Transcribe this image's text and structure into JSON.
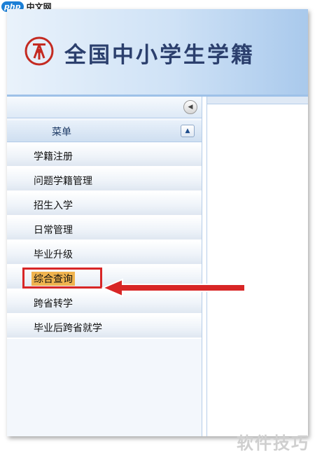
{
  "watermark": {
    "site_badge": "php",
    "site_name": "中文网",
    "corner_text": "软件技巧"
  },
  "header": {
    "title": "全国中小学生学籍",
    "logo_icon": "national-student-emblem-icon"
  },
  "panel": {
    "menu_title": "菜单",
    "collapse_icon": "left-arrow-circle-icon",
    "menu_toggle_icon": "up-arrow-icon"
  },
  "menu": {
    "items": [
      {
        "label": "学籍注册"
      },
      {
        "label": "问题学籍管理"
      },
      {
        "label": "招生入学"
      },
      {
        "label": "日常管理"
      },
      {
        "label": "毕业升级"
      },
      {
        "label": "综合查询",
        "highlighted": true
      },
      {
        "label": "跨省转学"
      },
      {
        "label": "毕业后跨省就学"
      }
    ]
  },
  "colors": {
    "highlight_bg": "#f0b44f",
    "annotation_red": "#d82626",
    "header_blue": "#a9c9ec"
  }
}
